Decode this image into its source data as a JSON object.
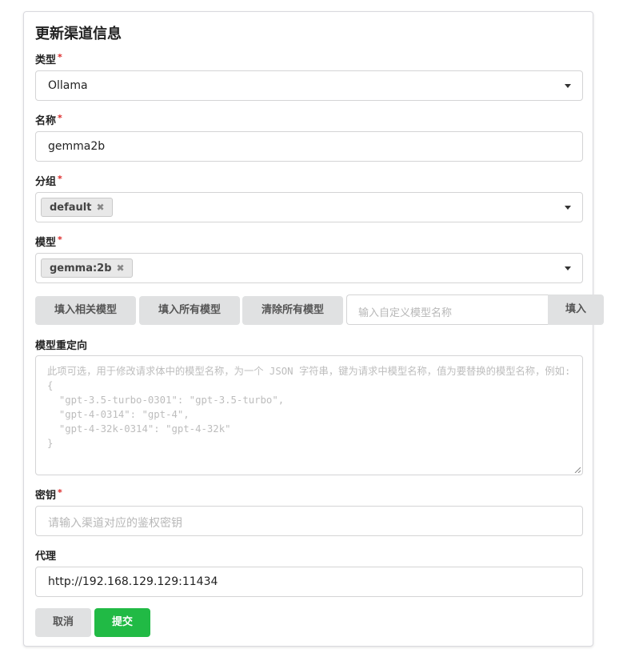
{
  "form": {
    "title": "更新渠道信息",
    "required_mark": "*",
    "type": {
      "label": "类型",
      "value": "Ollama"
    },
    "name": {
      "label": "名称",
      "value": "gemma2b"
    },
    "group": {
      "label": "分组",
      "chips": [
        "default"
      ]
    },
    "models": {
      "label": "模型",
      "chips": [
        "gemma:2b"
      ],
      "fill_related_label": "填入相关模型",
      "fill_all_label": "填入所有模型",
      "clear_all_label": "清除所有模型",
      "custom_placeholder": "输入自定义模型名称",
      "fill_button_label": "填入"
    },
    "model_mapping": {
      "label": "模型重定向",
      "placeholder": "此项可选，用于修改请求体中的模型名称，为一个 JSON 字符串，键为请求中模型名称，值为要替换的模型名称，例如:\n{\n  \"gpt-3.5-turbo-0301\": \"gpt-3.5-turbo\",\n  \"gpt-4-0314\": \"gpt-4\",\n  \"gpt-4-32k-0314\": \"gpt-4-32k\"\n}"
    },
    "key": {
      "label": "密钥",
      "placeholder": "请输入渠道对应的鉴权密钥"
    },
    "proxy": {
      "label": "代理",
      "value": "http://192.168.129.129:11434"
    },
    "cancel_label": "取消",
    "submit_label": "提交"
  },
  "icons": {
    "chip_remove": "close-icon",
    "dropdown": "chevron-down-icon"
  },
  "colors": {
    "submit": "#21ba45",
    "required": "#db2828"
  }
}
